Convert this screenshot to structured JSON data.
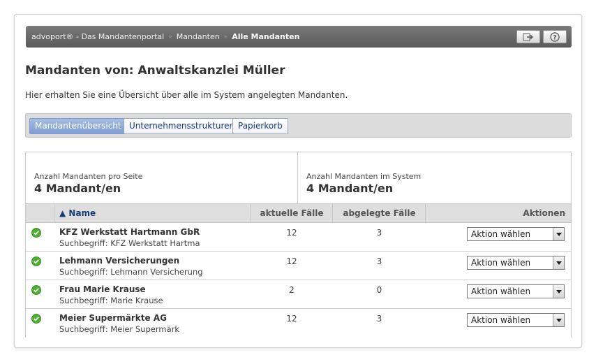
{
  "breadcrumb": {
    "items": [
      "advoport® - Das Mandantenportal",
      "Mandanten",
      "Alle Mandanten"
    ]
  },
  "header": {
    "title": "Mandanten von: Anwaltskanzlei Müller",
    "intro": "Hier erhalten Sie eine Übersicht über alle im System angelegten Mandanten."
  },
  "tabs": [
    {
      "label": "Mandantenübersicht",
      "active": true
    },
    {
      "label": "Unternehmensstrukturen",
      "active": false
    },
    {
      "label": "Papierkorb",
      "active": false
    }
  ],
  "stats": {
    "per_page_label": "Anzahl Mandanten pro Seite",
    "per_page_value": "4 Mandant/en",
    "in_system_label": "Anzahl Mandanten im System",
    "in_system_value": "4 Mandant/en"
  },
  "table": {
    "columns": {
      "name": "▲ Name",
      "current": "aktuelle Fälle",
      "archived": "abgelegte Fälle",
      "actions": "Aktionen"
    },
    "rows": [
      {
        "name": "KFZ Werkstatt Hartmann GbR",
        "search": "Suchbegriff: KFZ Werkstatt Hartma",
        "current": "12",
        "archived": "3",
        "action": "Aktion wählen"
      },
      {
        "name": "Lehmann Versicherungen",
        "search": "Suchbegriff: Lehmann Versicherung",
        "current": "12",
        "archived": "3",
        "action": "Aktion wählen"
      },
      {
        "name": "Frau Marie Krause",
        "search": "Suchbegriff: Marie Krause",
        "current": "2",
        "archived": "0",
        "action": "Aktion wählen"
      },
      {
        "name": "Meier Supermärkte AG",
        "search": "Suchbegriff: Meier Supermärk",
        "current": "12",
        "archived": "3",
        "action": "Aktion wählen"
      }
    ]
  },
  "icons": {
    "status": "check-circle-icon",
    "topbar_left": "switch-icon",
    "topbar_right": "help-icon"
  },
  "colors": {
    "accent": "#7d9dd2",
    "link": "#1a3b7a",
    "status_ok": "#4caf2e"
  }
}
